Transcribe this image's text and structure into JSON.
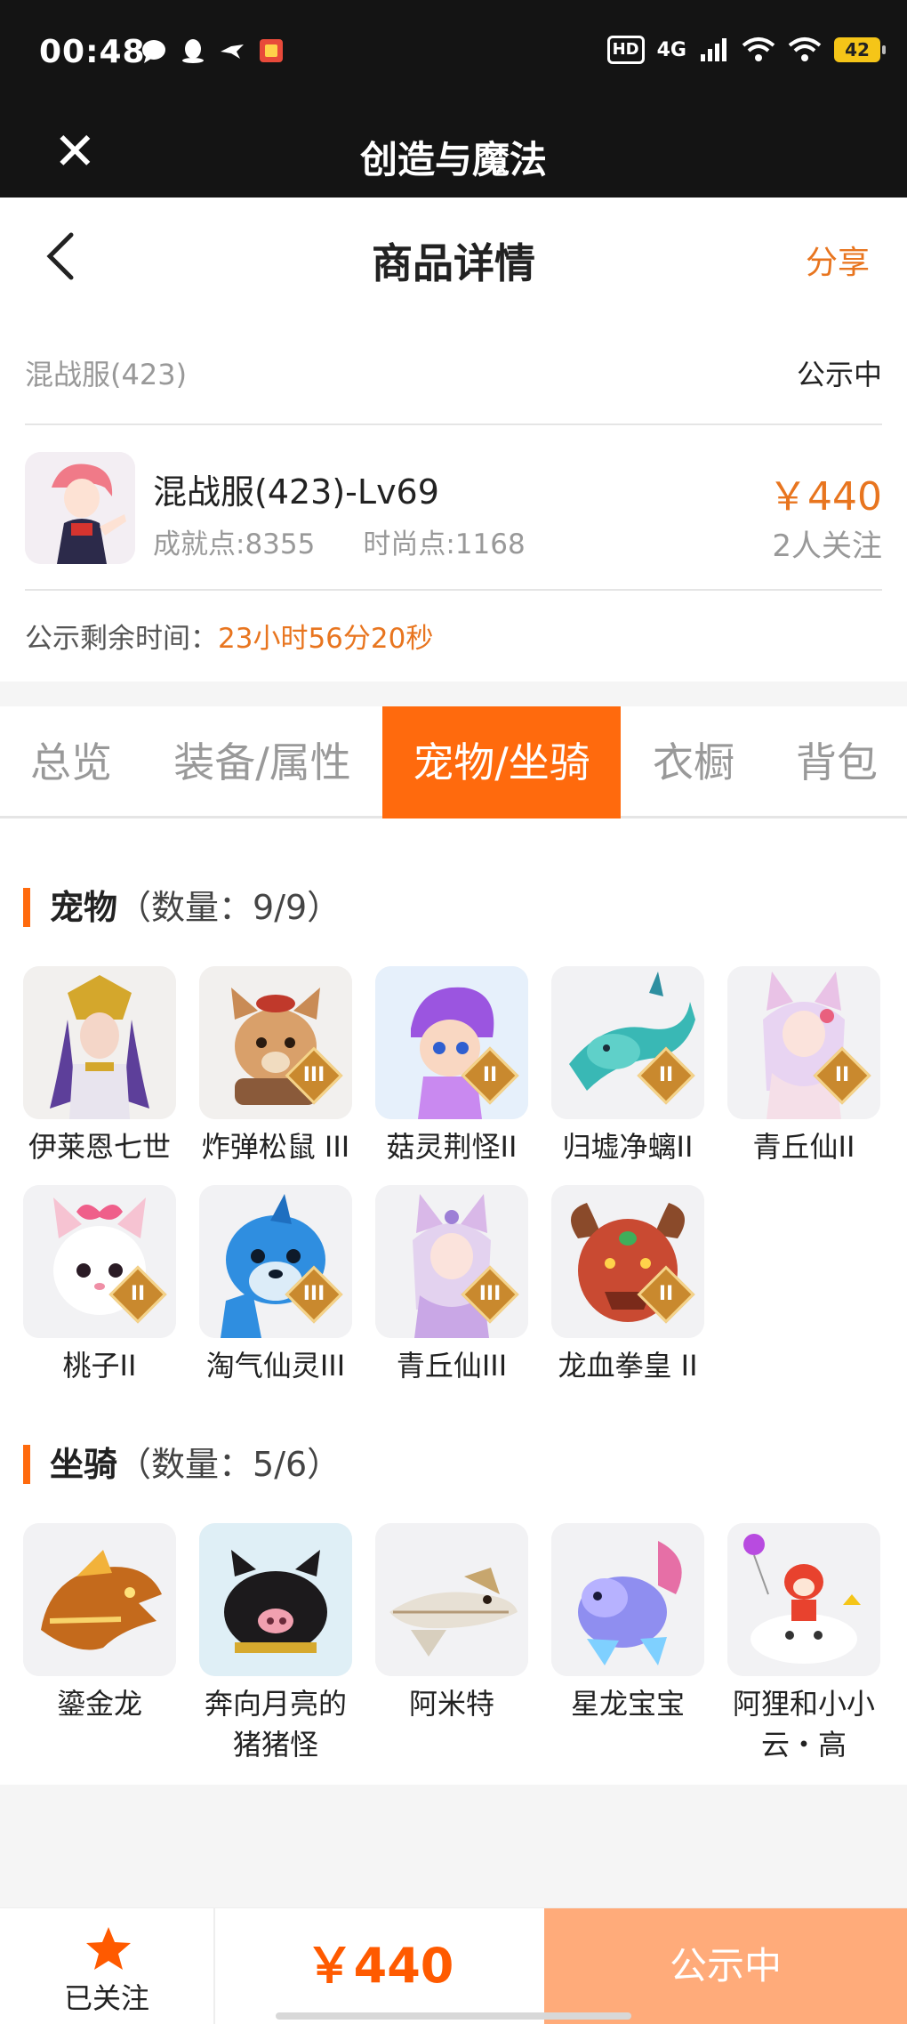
{
  "status_bar": {
    "time": "00:48",
    "hd": "HD",
    "network": "4G",
    "battery": "42"
  },
  "app_bar": {
    "title": "创造与魔法"
  },
  "header": {
    "title": "商品详情",
    "share": "分享"
  },
  "server": {
    "name": "混战服(423)",
    "status": "公示中"
  },
  "item": {
    "name": "混战服(423)-Lv69",
    "achievement": "成就点:8355",
    "fashion": "时尚点:1168",
    "price": "￥440",
    "followers": "2人关注"
  },
  "timer": {
    "label": "公示剩余时间：",
    "value": "23小时56分20秒"
  },
  "tabs": [
    "总览",
    "装备/属性",
    "宠物/坐骑",
    "衣橱",
    "背包"
  ],
  "active_tab": "宠物/坐骑",
  "pets": {
    "title": "宠物",
    "count": "（数量：9/9）",
    "items": [
      {
        "name": "伊莱恩七世",
        "rank": ""
      },
      {
        "name": "炸弹松鼠 III",
        "rank": "III"
      },
      {
        "name": "菇灵荆怪II",
        "rank": "II"
      },
      {
        "name": "归墟净螭II",
        "rank": "II"
      },
      {
        "name": "青丘仙II",
        "rank": "II"
      },
      {
        "name": "桃子II",
        "rank": "II"
      },
      {
        "name": "淘气仙灵III",
        "rank": "III"
      },
      {
        "name": "青丘仙III",
        "rank": "III"
      },
      {
        "name": "龙血拳皇 II",
        "rank": "II"
      }
    ]
  },
  "mounts": {
    "title": "坐骑",
    "count": "（数量：5/6）",
    "items": [
      {
        "name": "鎏金龙"
      },
      {
        "name": "奔向月亮的猪猪怪"
      },
      {
        "name": "阿米特"
      },
      {
        "name": "星龙宝宝"
      },
      {
        "name": "阿狸和小小云・高"
      }
    ]
  },
  "bottom_bar": {
    "follow_label": "已关注",
    "price": "￥440",
    "status": "公示中"
  },
  "colors": {
    "accent": "#ff6a0d",
    "price": "#e8751f",
    "rank_badge": "#c9892e"
  }
}
